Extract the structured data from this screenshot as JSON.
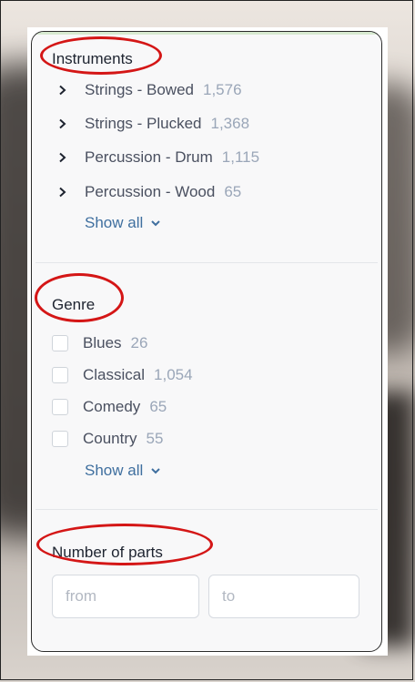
{
  "sections": {
    "instruments": {
      "title": "Instruments",
      "items": [
        {
          "label": "Strings - Bowed",
          "count": "1,576"
        },
        {
          "label": "Strings - Plucked",
          "count": "1,368"
        },
        {
          "label": "Percussion - Drum",
          "count": "1,115"
        },
        {
          "label": "Percussion - Wood",
          "count": "65"
        }
      ],
      "show_all": "Show all"
    },
    "genre": {
      "title": "Genre",
      "items": [
        {
          "label": "Blues",
          "count": "26"
        },
        {
          "label": "Classical",
          "count": "1,054"
        },
        {
          "label": "Comedy",
          "count": "65"
        },
        {
          "label": "Country",
          "count": "55"
        }
      ],
      "show_all": "Show all"
    },
    "parts": {
      "title": "Number of parts",
      "from_placeholder": "from",
      "to_placeholder": "to"
    }
  },
  "icons": {
    "expand": "chevron-right-icon",
    "show_all": "chevron-down-icon"
  },
  "colors": {
    "annotation": "#d41616",
    "link": "#3f6f9f",
    "count": "#9aa6b8"
  }
}
